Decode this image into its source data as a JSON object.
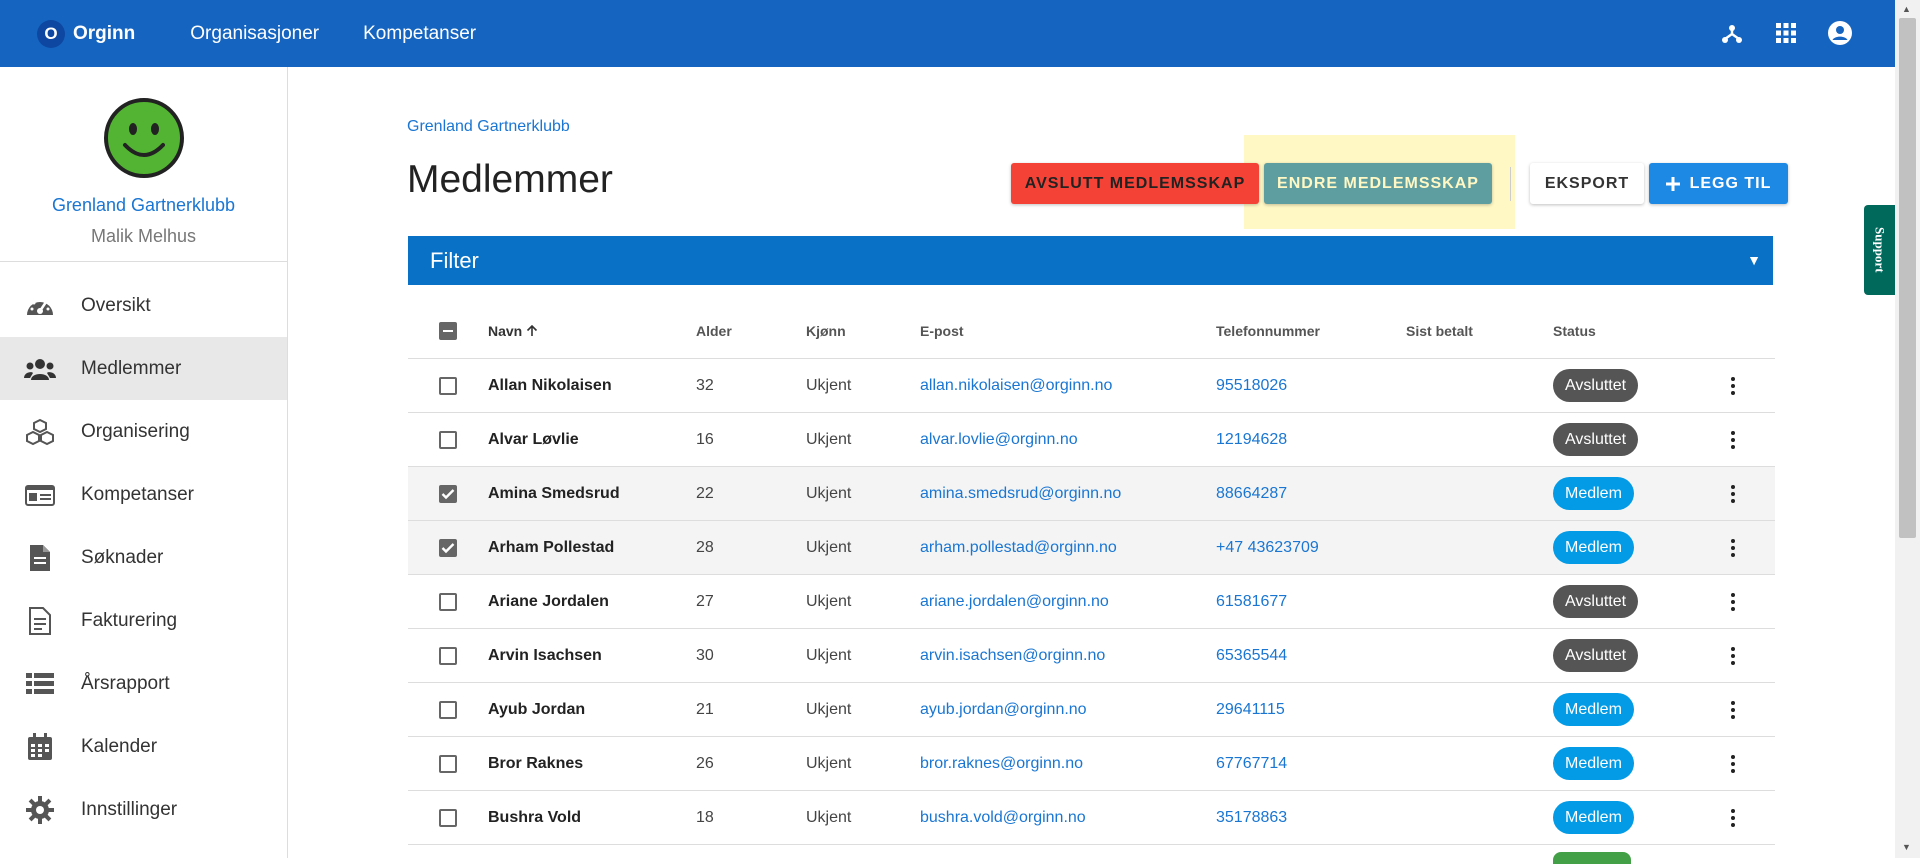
{
  "topbar": {
    "brand_letter": "O",
    "brand_name": "Orginn",
    "nav": [
      "Organisasjoner",
      "Kompetanser"
    ],
    "icons": [
      "hierarchy-icon",
      "apps-grid-icon",
      "account-circle-icon"
    ]
  },
  "sidebar": {
    "org_name": "Grenland Gartnerklubb",
    "user_name": "Malik Melhus",
    "items": [
      {
        "label": "Oversikt",
        "icon": "dashboard-gauge-icon"
      },
      {
        "label": "Medlemmer",
        "icon": "people-icon",
        "active": true
      },
      {
        "label": "Organisering",
        "icon": "boxes-icon"
      },
      {
        "label": "Kompetanser",
        "icon": "id-card-icon"
      },
      {
        "label": "Søknader",
        "icon": "document-icon"
      },
      {
        "label": "Fakturering",
        "icon": "invoice-icon"
      },
      {
        "label": "Årsrapport",
        "icon": "list-icon"
      },
      {
        "label": "Kalender",
        "icon": "calendar-icon"
      },
      {
        "label": "Innstillinger",
        "icon": "gear-icon"
      }
    ]
  },
  "main": {
    "breadcrumb": "Grenland Gartnerklubb",
    "title": "Medlemmer",
    "buttons": {
      "end_membership": "AVSLUTT MEDLEMSSKAP",
      "change_membership": "ENDRE MEDLEMSSKAP",
      "export": "EKSPORT",
      "add": "LEGG TIL"
    },
    "filter_label": "Filter"
  },
  "table": {
    "headers": {
      "name": "Navn",
      "age": "Alder",
      "gender": "Kjønn",
      "email": "E-post",
      "phone": "Telefonnummer",
      "last_paid": "Sist betalt",
      "status": "Status"
    },
    "rows": [
      {
        "name": "Allan Nikolaisen",
        "age": "32",
        "gender": "Ukjent",
        "email": "allan.nikolaisen@orginn.no",
        "phone": "95518026",
        "last_paid": "",
        "status": "Avsluttet",
        "checked": false
      },
      {
        "name": "Alvar Løvlie",
        "age": "16",
        "gender": "Ukjent",
        "email": "alvar.lovlie@orginn.no",
        "phone": "12194628",
        "last_paid": "",
        "status": "Avsluttet",
        "checked": false
      },
      {
        "name": "Amina Smedsrud",
        "age": "22",
        "gender": "Ukjent",
        "email": "amina.smedsrud@orginn.no",
        "phone": "88664287",
        "last_paid": "",
        "status": "Medlem",
        "checked": true
      },
      {
        "name": "Arham Pollestad",
        "age": "28",
        "gender": "Ukjent",
        "email": "arham.pollestad@orginn.no",
        "phone": "+47 43623709",
        "last_paid": "",
        "status": "Medlem",
        "checked": true
      },
      {
        "name": "Ariane Jordalen",
        "age": "27",
        "gender": "Ukjent",
        "email": "ariane.jordalen@orginn.no",
        "phone": "61581677",
        "last_paid": "",
        "status": "Avsluttet",
        "checked": false
      },
      {
        "name": "Arvin Isachsen",
        "age": "30",
        "gender": "Ukjent",
        "email": "arvin.isachsen@orginn.no",
        "phone": "65365544",
        "last_paid": "",
        "status": "Avsluttet",
        "checked": false
      },
      {
        "name": "Ayub Jordan",
        "age": "21",
        "gender": "Ukjent",
        "email": "ayub.jordan@orginn.no",
        "phone": "29641115",
        "last_paid": "",
        "status": "Medlem",
        "checked": false
      },
      {
        "name": "Bror Raknes",
        "age": "26",
        "gender": "Ukjent",
        "email": "bror.raknes@orginn.no",
        "phone": "67767714",
        "last_paid": "",
        "status": "Medlem",
        "checked": false
      },
      {
        "name": "Bushra Vold",
        "age": "18",
        "gender": "Ukjent",
        "email": "bushra.vold@orginn.no",
        "phone": "35178863",
        "last_paid": "",
        "status": "Medlem",
        "checked": false
      }
    ]
  },
  "support_label": "Support",
  "colors": {
    "topbar": "#1565c0",
    "filter": "#0a72c6",
    "end_button": "#f44336",
    "change_button": "#5f9ea0",
    "add_button": "#1e88e5",
    "status_ended": "#555555",
    "status_member": "#039be5",
    "support": "#00695c"
  }
}
